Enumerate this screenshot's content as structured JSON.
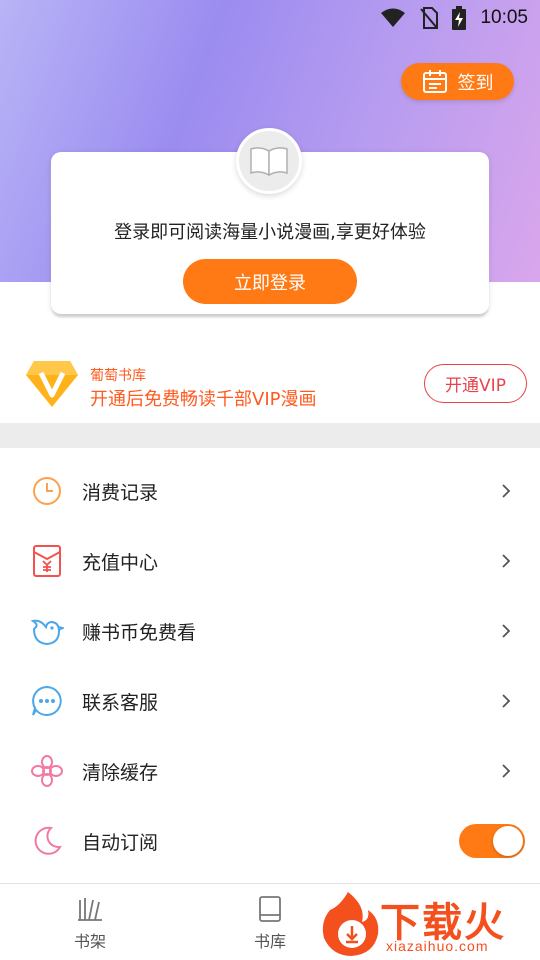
{
  "status_bar": {
    "time": "10:05"
  },
  "header": {
    "checkin_label": "签到"
  },
  "login_card": {
    "message": "登录即可阅读海量小说漫画,享更好体验",
    "login_button": "立即登录"
  },
  "vip": {
    "title": "葡萄书库",
    "subtitle": "开通后免费畅读千部VIP漫画",
    "button": "开通VIP"
  },
  "menu": {
    "items": [
      {
        "label": "消费记录",
        "icon": "clock-icon"
      },
      {
        "label": "充值中心",
        "icon": "yen-envelope-icon"
      },
      {
        "label": "赚书币免费看",
        "icon": "bird-icon"
      },
      {
        "label": "联系客服",
        "icon": "chat-bubble-icon"
      },
      {
        "label": "清除缓存",
        "icon": "flower-icon"
      },
      {
        "label": "自动订阅",
        "icon": "moon-icon",
        "toggle_on": true
      }
    ]
  },
  "tabbar": {
    "tabs": [
      {
        "label": "书架",
        "icon": "bookshelf-icon"
      },
      {
        "label": "书库",
        "icon": "book-icon"
      }
    ]
  },
  "watermark": {
    "text": "下载火",
    "url_text": "xiazaihuo.com"
  },
  "colors": {
    "accent": "#ff7a14",
    "vip_red": "#e8434a",
    "hero_start": "#b8b4f6",
    "hero_end": "#d9a6ec"
  }
}
